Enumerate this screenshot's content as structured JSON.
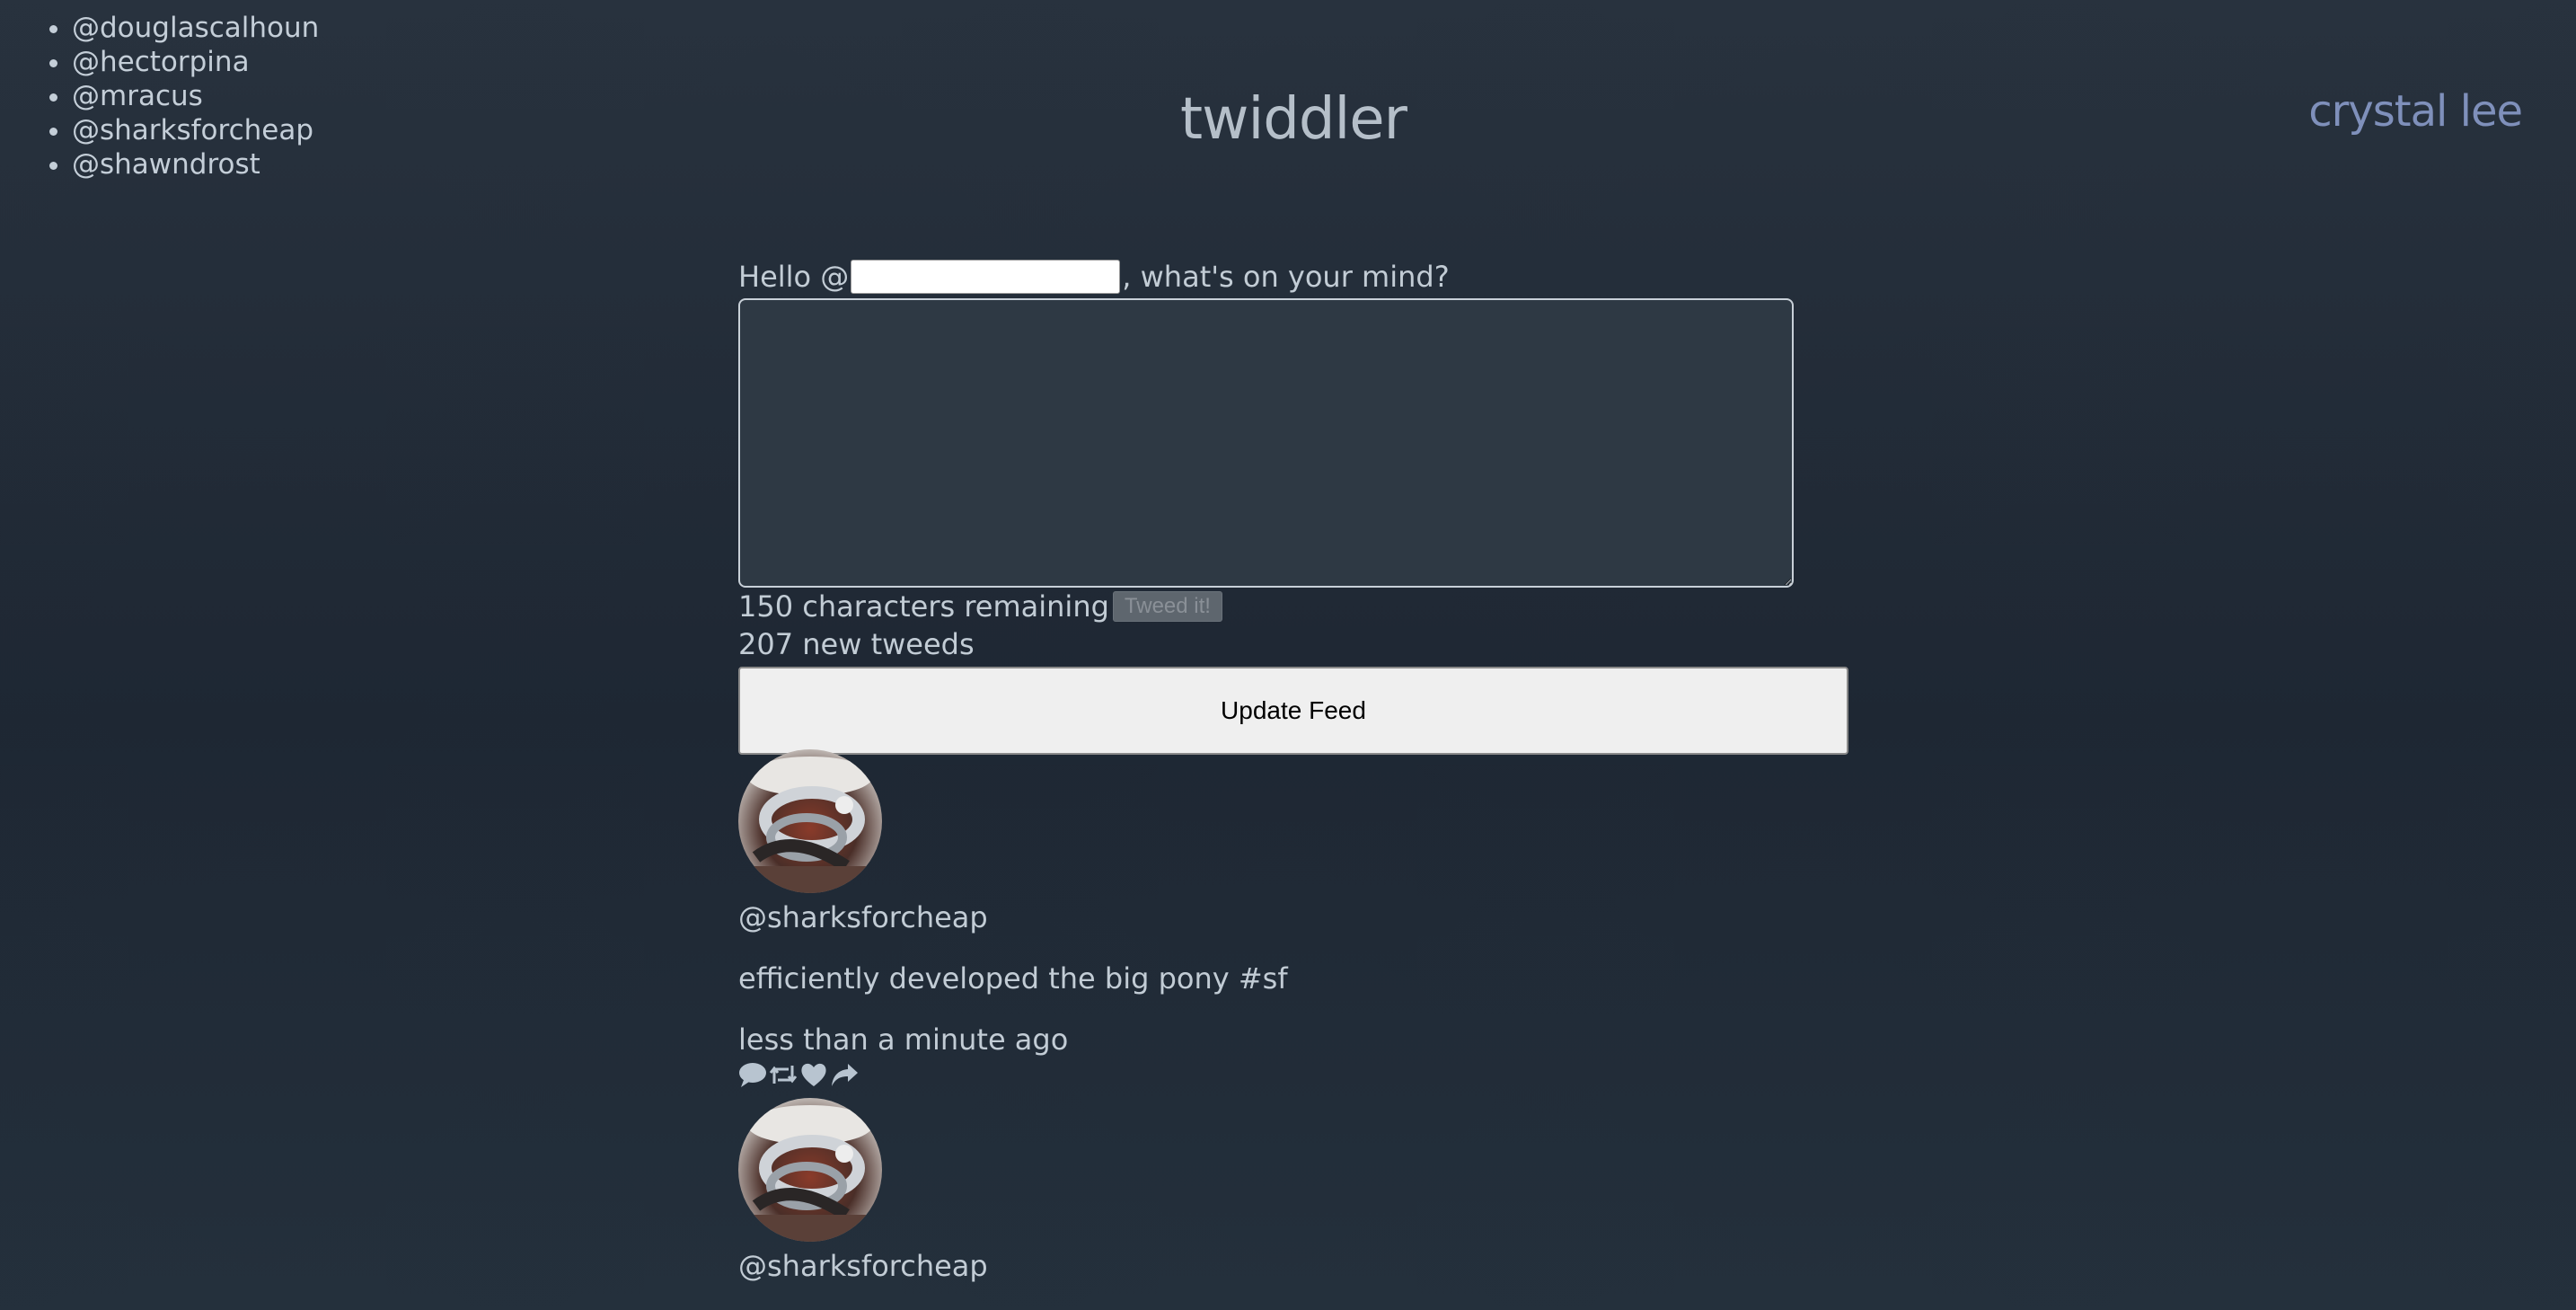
{
  "users": [
    "@douglascalhoun",
    "@hectorpina",
    "@mracus",
    "@sharksforcheap",
    "@shawndrost"
  ],
  "header": {
    "title": "twiddler",
    "username": "crystal lee"
  },
  "compose": {
    "hello_prefix": "Hello @",
    "hello_suffix": ", what's on your mind?",
    "username_value": "",
    "message_value": "",
    "chars_remaining": "150 characters remaining",
    "tweet_button": "Tweed it!",
    "new_tweets": "207 new tweeds",
    "update_button": "Update Feed"
  },
  "feed": [
    {
      "handle": "@sharksforcheap",
      "message": "efficiently developed the big pony #sf",
      "time": "less than a minute ago"
    },
    {
      "handle": "@sharksforcheap"
    }
  ],
  "icons": [
    "comment-icon",
    "retweet-icon",
    "heart-icon",
    "share-icon"
  ],
  "colors": {
    "background": "#222c38",
    "text": "#c2ccd5",
    "username": "#7f90bb",
    "icon": "#b8c4d0"
  }
}
